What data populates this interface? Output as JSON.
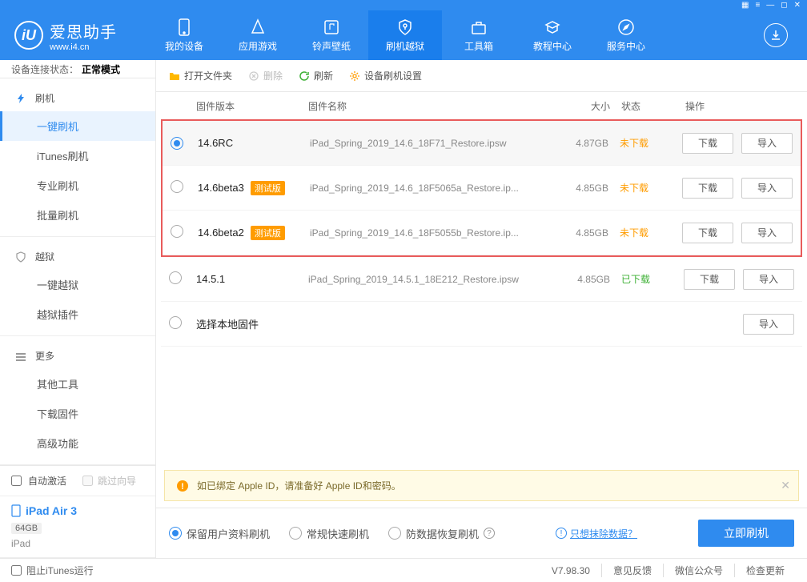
{
  "app": {
    "title": "爱思助手",
    "site": "www.i4.cn"
  },
  "nav": [
    {
      "label": "我的设备"
    },
    {
      "label": "应用游戏"
    },
    {
      "label": "铃声壁纸"
    },
    {
      "label": "刷机越狱"
    },
    {
      "label": "工具箱"
    },
    {
      "label": "教程中心"
    },
    {
      "label": "服务中心"
    }
  ],
  "status": {
    "label": "设备连接状态：",
    "value": "正常模式"
  },
  "sidebar": {
    "groups": [
      {
        "header": "刷机",
        "items": [
          "一键刷机",
          "iTunes刷机",
          "专业刷机",
          "批量刷机"
        ]
      },
      {
        "header": "越狱",
        "items": [
          "一键越狱",
          "越狱插件"
        ]
      },
      {
        "header": "更多",
        "items": [
          "其他工具",
          "下载固件",
          "高级功能"
        ]
      }
    ]
  },
  "sbottom": {
    "auto_activate": "自动激活",
    "skip_guide": "跳过向导",
    "device_name": "iPad Air 3",
    "storage": "64GB",
    "device_type": "iPad",
    "block_itunes": "阻止iTunes运行"
  },
  "toolbar": {
    "open": "打开文件夹",
    "delete": "删除",
    "refresh": "刷新",
    "settings": "设备刷机设置"
  },
  "columns": {
    "ver": "固件版本",
    "name": "固件名称",
    "size": "大小",
    "status": "状态",
    "ops": "操作"
  },
  "rows": [
    {
      "ver": "14.6RC",
      "beta": false,
      "name": "iPad_Spring_2019_14.6_18F71_Restore.ipsw",
      "size": "4.87GB",
      "status": "未下载",
      "downloaded": false,
      "selected": true
    },
    {
      "ver": "14.6beta3",
      "beta": true,
      "name": "iPad_Spring_2019_14.6_18F5065a_Restore.ip...",
      "size": "4.85GB",
      "status": "未下载",
      "downloaded": false,
      "selected": false
    },
    {
      "ver": "14.6beta2",
      "beta": true,
      "name": "iPad_Spring_2019_14.6_18F5055b_Restore.ip...",
      "size": "4.85GB",
      "status": "未下载",
      "downloaded": false,
      "selected": false
    }
  ],
  "rows_tail": [
    {
      "ver": "14.5.1",
      "beta": false,
      "name": "iPad_Spring_2019_14.5.1_18E212_Restore.ipsw",
      "size": "4.85GB",
      "status": "已下载",
      "downloaded": true,
      "selected": false
    }
  ],
  "local_row": {
    "label": "选择本地固件"
  },
  "btn": {
    "download": "下载",
    "import": "导入"
  },
  "beta_label": "测试版",
  "notice": "如已绑定 Apple ID，请准备好 Apple ID和密码。",
  "flash": {
    "opts": [
      "保留用户资料刷机",
      "常规快速刷机",
      "防数据恢复刷机"
    ],
    "erase_link": "只想抹除数据？",
    "go": "立即刷机"
  },
  "footer": {
    "version": "V7.98.30",
    "feedback": "意见反馈",
    "wechat": "微信公众号",
    "update": "检查更新"
  }
}
